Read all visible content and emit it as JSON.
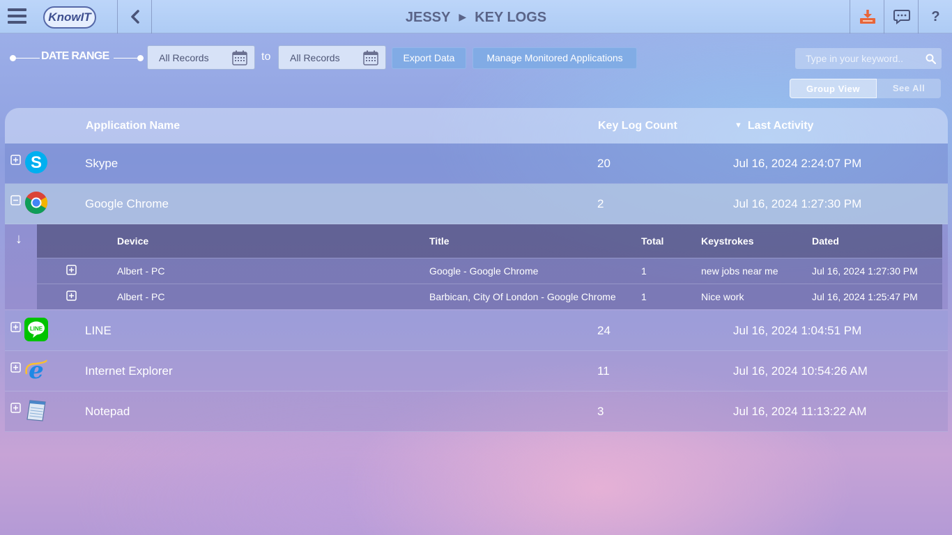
{
  "header": {
    "logo_text": "KnowIT",
    "breadcrumb_user": "JESSY",
    "breadcrumb_page": "KEY LOGS",
    "help_label": "?"
  },
  "filters": {
    "date_range_label": "DATE RANGE",
    "from_value": "All Records",
    "to_label": "to",
    "to_value": "All Records",
    "export_label": "Export Data",
    "manage_label": "Manage Monitored Applications",
    "search_placeholder": "Type in your keyword..",
    "group_view_label": "Group View",
    "see_all_label": "See All"
  },
  "table": {
    "columns": {
      "app_name": "Application Name",
      "count": "Key Log Count",
      "last_activity": "Last Activity"
    },
    "rows": [
      {
        "name": "Skype",
        "count": "20",
        "last_activity": "Jul 16, 2024 2:24:07 PM",
        "icon": "skype-icon",
        "expanded": false
      },
      {
        "name": "Google Chrome",
        "count": "2",
        "last_activity": "Jul 16, 2024 1:27:30 PM",
        "icon": "chrome-icon",
        "expanded": true
      },
      {
        "name": "LINE",
        "count": "24",
        "last_activity": "Jul 16, 2024 1:04:51 PM",
        "icon": "line-icon",
        "expanded": false
      },
      {
        "name": "Internet Explorer",
        "count": "11",
        "last_activity": "Jul 16, 2024 10:54:26 AM",
        "icon": "internet-explorer-icon",
        "expanded": false
      },
      {
        "name": "Notepad",
        "count": "3",
        "last_activity": "Jul 16, 2024 11:13:22 AM",
        "icon": "notepad-icon",
        "expanded": false
      }
    ]
  },
  "subtable": {
    "columns": {
      "device": "Device",
      "title": "Title",
      "total": "Total",
      "keystrokes": "Keystrokes",
      "dated": "Dated"
    },
    "rows": [
      {
        "device": "Albert - PC",
        "title": "Google - Google Chrome",
        "total": "1",
        "keystrokes": "new jobs near me",
        "dated": "Jul 16, 2024 1:27:30 PM"
      },
      {
        "device": "Albert - PC",
        "title": "Barbican, City Of London - Google Chrome",
        "total": "1",
        "keystrokes": "Nice work",
        "dated": "Jul 16, 2024 1:25:47 PM"
      }
    ]
  },
  "colors": {
    "accent_orange": "#e8653a",
    "skype_blue": "#00aff0",
    "line_green": "#00c300"
  }
}
